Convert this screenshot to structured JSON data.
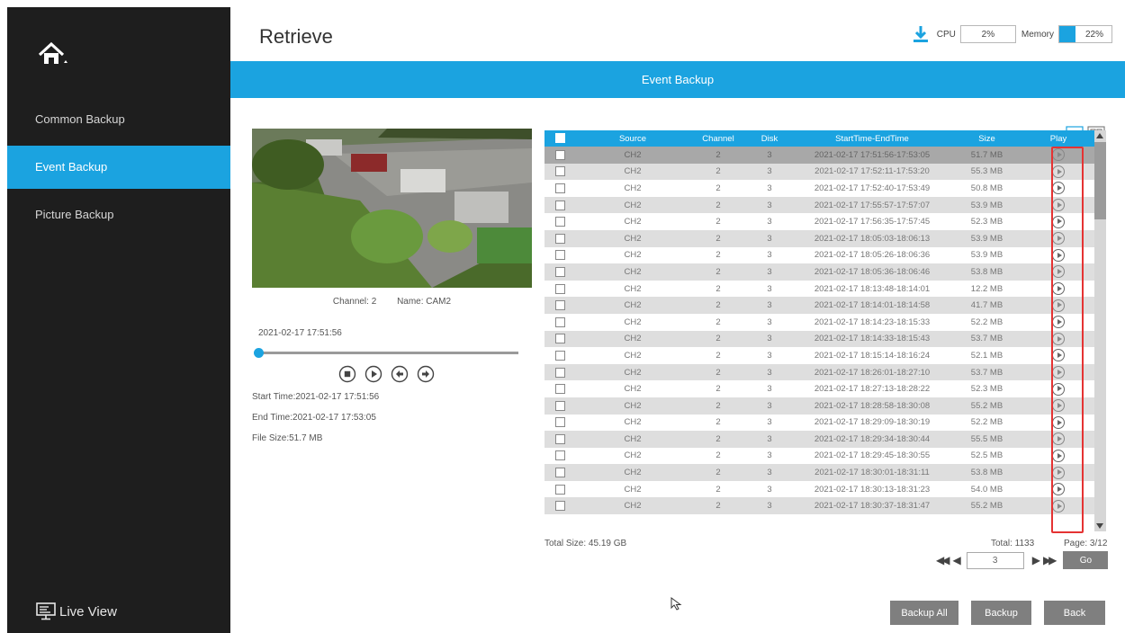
{
  "sidebar": {
    "home_icon": "home-icon",
    "items": [
      {
        "label": "Common Backup",
        "active": false
      },
      {
        "label": "Event Backup",
        "active": true
      },
      {
        "label": "Picture Backup",
        "active": false
      }
    ],
    "live_view_label": "Live View"
  },
  "header": {
    "title": "Retrieve",
    "cpu_label": "CPU",
    "cpu_value": "2%",
    "memory_label": "Memory",
    "memory_value": "22%",
    "memory_fraction": 0.22
  },
  "banner": {
    "title": "Event Backup"
  },
  "preview": {
    "channel_text": "Channel: 2",
    "name_text": "Name: CAM2",
    "current_time": "2021-02-17 17:51:56",
    "progress_fraction": 0.0,
    "start_time": "Start Time:2021-02-17 17:51:56",
    "end_time": "End Time:2021-02-17 17:53:05",
    "file_size": "File Size:51.7 MB"
  },
  "table": {
    "columns": [
      "Source",
      "Channel",
      "Disk",
      "StartTime-EndTime",
      "Size",
      "Play"
    ],
    "rows": [
      [
        "CH2",
        "2",
        "3",
        "2021-02-17 17:51:56-17:53:05",
        "51.7 MB"
      ],
      [
        "CH2",
        "2",
        "3",
        "2021-02-17 17:52:11-17:53:20",
        "55.3 MB"
      ],
      [
        "CH2",
        "2",
        "3",
        "2021-02-17 17:52:40-17:53:49",
        "50.8 MB"
      ],
      [
        "CH2",
        "2",
        "3",
        "2021-02-17 17:55:57-17:57:07",
        "53.9 MB"
      ],
      [
        "CH2",
        "2",
        "3",
        "2021-02-17 17:56:35-17:57:45",
        "52.3 MB"
      ],
      [
        "CH2",
        "2",
        "3",
        "2021-02-17 18:05:03-18:06:13",
        "53.9 MB"
      ],
      [
        "CH2",
        "2",
        "3",
        "2021-02-17 18:05:26-18:06:36",
        "53.9 MB"
      ],
      [
        "CH2",
        "2",
        "3",
        "2021-02-17 18:05:36-18:06:46",
        "53.8 MB"
      ],
      [
        "CH2",
        "2",
        "3",
        "2021-02-17 18:13:48-18:14:01",
        "12.2 MB"
      ],
      [
        "CH2",
        "2",
        "3",
        "2021-02-17 18:14:01-18:14:58",
        "41.7 MB"
      ],
      [
        "CH2",
        "2",
        "3",
        "2021-02-17 18:14:23-18:15:33",
        "52.2 MB"
      ],
      [
        "CH2",
        "2",
        "3",
        "2021-02-17 18:14:33-18:15:43",
        "53.7 MB"
      ],
      [
        "CH2",
        "2",
        "3",
        "2021-02-17 18:15:14-18:16:24",
        "52.1 MB"
      ],
      [
        "CH2",
        "2",
        "3",
        "2021-02-17 18:26:01-18:27:10",
        "53.7 MB"
      ],
      [
        "CH2",
        "2",
        "3",
        "2021-02-17 18:27:13-18:28:22",
        "52.3 MB"
      ],
      [
        "CH2",
        "2",
        "3",
        "2021-02-17 18:28:58-18:30:08",
        "55.2 MB"
      ],
      [
        "CH2",
        "2",
        "3",
        "2021-02-17 18:29:09-18:30:19",
        "52.2 MB"
      ],
      [
        "CH2",
        "2",
        "3",
        "2021-02-17 18:29:34-18:30:44",
        "55.5 MB"
      ],
      [
        "CH2",
        "2",
        "3",
        "2021-02-17 18:29:45-18:30:55",
        "52.5 MB"
      ],
      [
        "CH2",
        "2",
        "3",
        "2021-02-17 18:30:01-18:31:11",
        "53.8 MB"
      ],
      [
        "CH2",
        "2",
        "3",
        "2021-02-17 18:30:13-18:31:23",
        "54.0 MB"
      ],
      [
        "CH2",
        "2",
        "3",
        "2021-02-17 18:30:37-18:31:47",
        "55.2 MB"
      ]
    ],
    "selected_row": 0
  },
  "footer": {
    "total_size": "Total Size: 45.19 GB",
    "total": "Total: 1133",
    "page": "Page: 3/12",
    "page_input_value": "3",
    "go_label": "Go"
  },
  "buttons": {
    "backup_all": "Backup All",
    "backup": "Backup",
    "back": "Back"
  },
  "colors": {
    "accent": "#1ba3e0",
    "sidebar_bg": "#1e1e1e",
    "highlight": "#e53333"
  }
}
